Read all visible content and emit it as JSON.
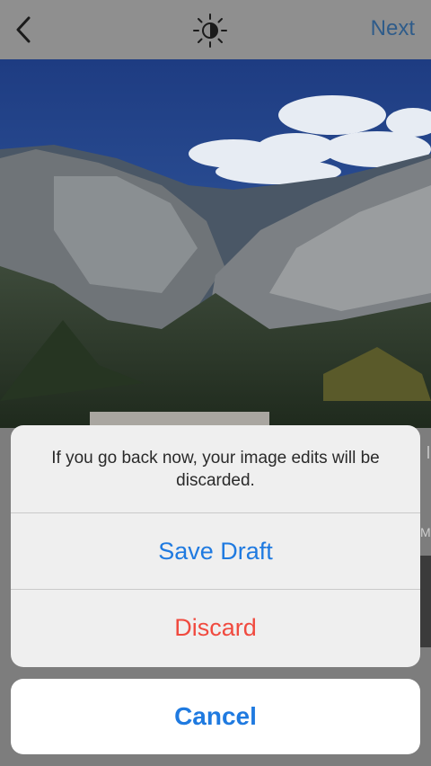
{
  "header": {
    "back_icon": "chevron-left-icon",
    "adjust_icon": "lux-sun-icon",
    "next_label": "Next"
  },
  "side_peek": {
    "text": "Mo"
  },
  "action_sheet": {
    "message": "If you go back now, your image edits will be discarded.",
    "save_draft_label": "Save Draft",
    "discard_label": "Discard",
    "cancel_label": "Cancel"
  },
  "colors": {
    "action_blue": "#1f7ae0",
    "destructive_red": "#f04a3f",
    "next_blue": "#2f5c8a"
  }
}
